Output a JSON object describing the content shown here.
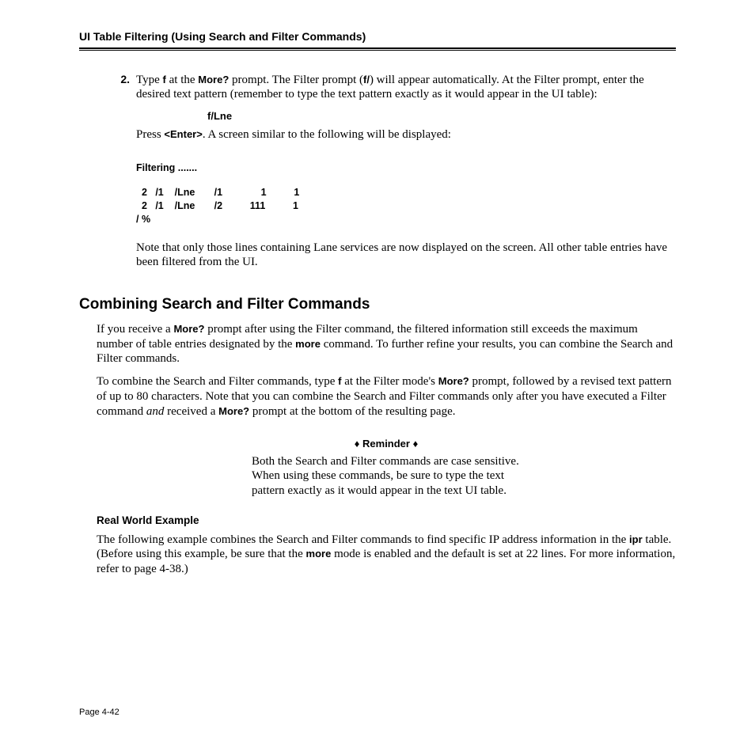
{
  "header": "UI Table Filtering (Using Search and Filter Commands)",
  "step": {
    "number": "2.",
    "para1": {
      "t1": "Type ",
      "cmd": "f",
      "t2": " at the ",
      "prompt": "More?",
      "t3": " prompt. The Filter prompt (",
      "fp": "f/",
      "t4": ") will appear automatically. At the Filter prompt, enter the desired text pattern (remember to type the text pattern exactly as it would appear in the UI table):"
    },
    "sample": "f/Lne",
    "para2": {
      "t1": "Press ",
      "key": "<Enter>",
      "t2": ". A screen similar to the following will be displayed:"
    },
    "terminal_header": "Filtering .......",
    "terminal_rows": "  2   /1    /Lne       /1              1          1\n  2   /1    /Lne       /2          111          1\n/ %",
    "note": "Note that only those lines containing Lane services are now displayed on the screen. All other table entries have been filtered from the UI."
  },
  "section": {
    "title": "Combining Search and Filter Commands",
    "p1": {
      "t1": "If you receive a ",
      "b1": "More?",
      "t2": " prompt after using the Filter command, the filtered information still exceeds the maximum number of table entries designated by the ",
      "b2": "more",
      "t3": " command. To further refine your results, you can combine the Search and Filter commands."
    },
    "p2": {
      "t1": "To combine the Search and Filter commands, type ",
      "cmd": "f",
      "t2": " at the Filter mode's ",
      "b1": "More?",
      "t3": " prompt, followed by a revised text pattern of up to 80 characters. Note that you can combine the Search and Filter commands only after you have executed a Filter command ",
      "ital": "and",
      "t4": " received a ",
      "b2": "More?",
      "t5": " prompt at the bottom of the resulting page."
    },
    "reminder_title": "♦ Reminder ♦",
    "reminder_body": "Both the Search and Filter commands are case sensitive. When using these commands, be sure to type the text pattern exactly as it would appear in the text UI table.",
    "example_head": "Real World Example",
    "example_body": {
      "t1": "The following example combines the Search and Filter commands to find specific IP address information in the ",
      "b1": "ipr",
      "t2": " table. (Before using this example, be sure that the ",
      "b2": "more",
      "t3": " mode is enabled and the default is set at 22 lines. For more information, refer to page 4-38.)"
    }
  },
  "footer": "Page 4-42"
}
